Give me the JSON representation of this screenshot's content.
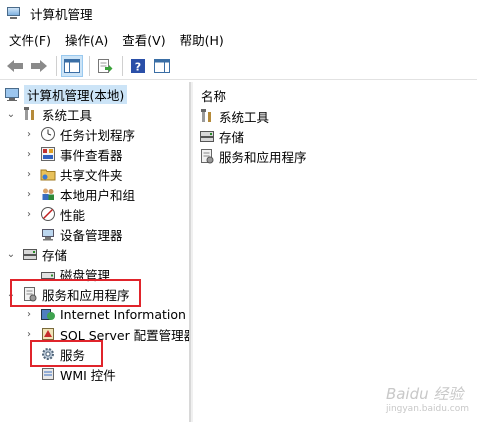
{
  "window": {
    "title": "计算机管理"
  },
  "menu": [
    {
      "label": "文件(F)"
    },
    {
      "label": "操作(A)"
    },
    {
      "label": "查看(V)"
    },
    {
      "label": "帮助(H)"
    }
  ],
  "tree": {
    "root": "计算机管理(本地)",
    "system_tools": {
      "label": "系统工具",
      "children": [
        "任务计划程序",
        "事件查看器",
        "共享文件夹",
        "本地用户和组",
        "性能",
        "设备管理器"
      ]
    },
    "storage": {
      "label": "存储",
      "children": [
        "磁盘管理"
      ]
    },
    "services_apps": {
      "label": "服务和应用程序",
      "children": [
        "Internet Information S",
        "SQL Server 配置管理器",
        "服务",
        "WMI 控件"
      ]
    }
  },
  "right_pane": {
    "column_header": "名称",
    "items": [
      "系统工具",
      "存储",
      "服务和应用程序"
    ]
  },
  "watermark": {
    "main": "Baidu 经验",
    "sub": "jingyan.baidu.com"
  },
  "colors": {
    "selection": "#cce4f7",
    "annotation": "#e0242b"
  }
}
